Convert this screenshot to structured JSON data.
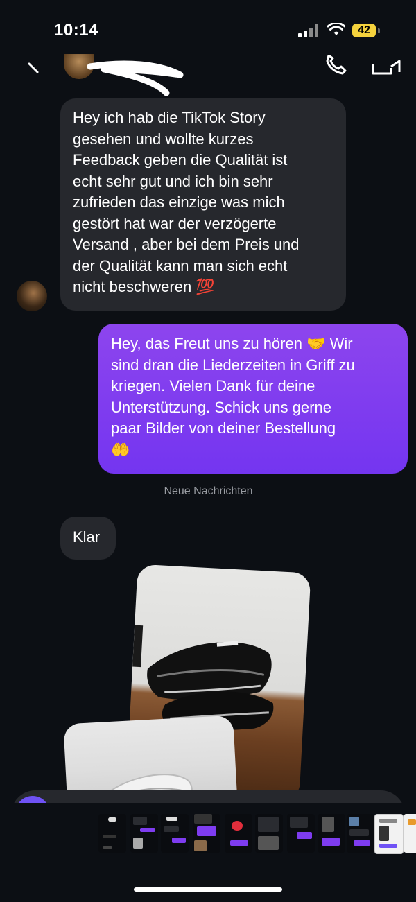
{
  "status_bar": {
    "time": "10:14",
    "battery": "42",
    "battery_color": "#f5d23d"
  },
  "header": {
    "back_icon": "chevron-left-icon",
    "call_icon": "phone-icon",
    "video_icon": "video-camera-icon"
  },
  "messages": [
    {
      "direction": "incoming",
      "lines": [
        "Hey ich hab die TikTok Story",
        "gesehen und wollte kurzes",
        "Feedback geben die Qualität ist",
        "echt sehr gut und ich bin sehr",
        "zufrieden das einzige was mich",
        "gestört hat war der verzögerte",
        "Versand , aber bei dem Preis und",
        "der Qualität kann man sich echt",
        "nicht beschweren 💯"
      ]
    },
    {
      "direction": "outgoing",
      "lines": [
        "Hey, das Freut uns zu hören 🤝 Wir",
        "sind dran die Liederzeiten in Griff zu",
        "kriegen. Vielen Dank für deine",
        "Unterstützung. Schick uns gerne",
        "paar Bilder von deiner Bestellung",
        "🤲"
      ]
    },
    {
      "direction": "incoming",
      "lines": [
        "Klar"
      ]
    }
  ],
  "divider_label": "Neue Nachrichten",
  "colors": {
    "background": "#0c0f14",
    "incoming_bubble": "#26282d",
    "outgoing_bubble": "#7e3cf0",
    "accent": "#6f52f5"
  }
}
